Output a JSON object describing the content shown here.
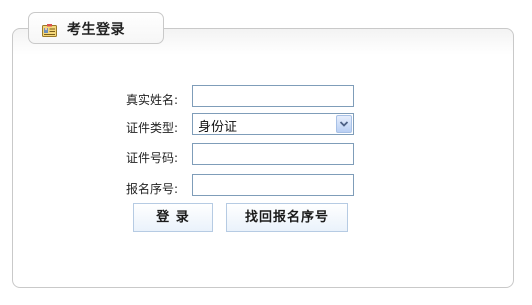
{
  "tab": {
    "title": "考生登录",
    "icon": "id-card-icon"
  },
  "form": {
    "name_label": "真实姓名:",
    "name_value": "",
    "id_type_label": "证件类型:",
    "id_type_selected": "身份证",
    "id_number_label": "证件号码:",
    "id_number_value": "",
    "reg_number_label": "报名序号:",
    "reg_number_value": ""
  },
  "buttons": {
    "login_label": "登 录",
    "retrieve_label": "找回报名序号"
  },
  "colors": {
    "input_border": "#7f9db9",
    "button_border": "#b6cbe3",
    "panel_border": "#c9c9c9"
  }
}
